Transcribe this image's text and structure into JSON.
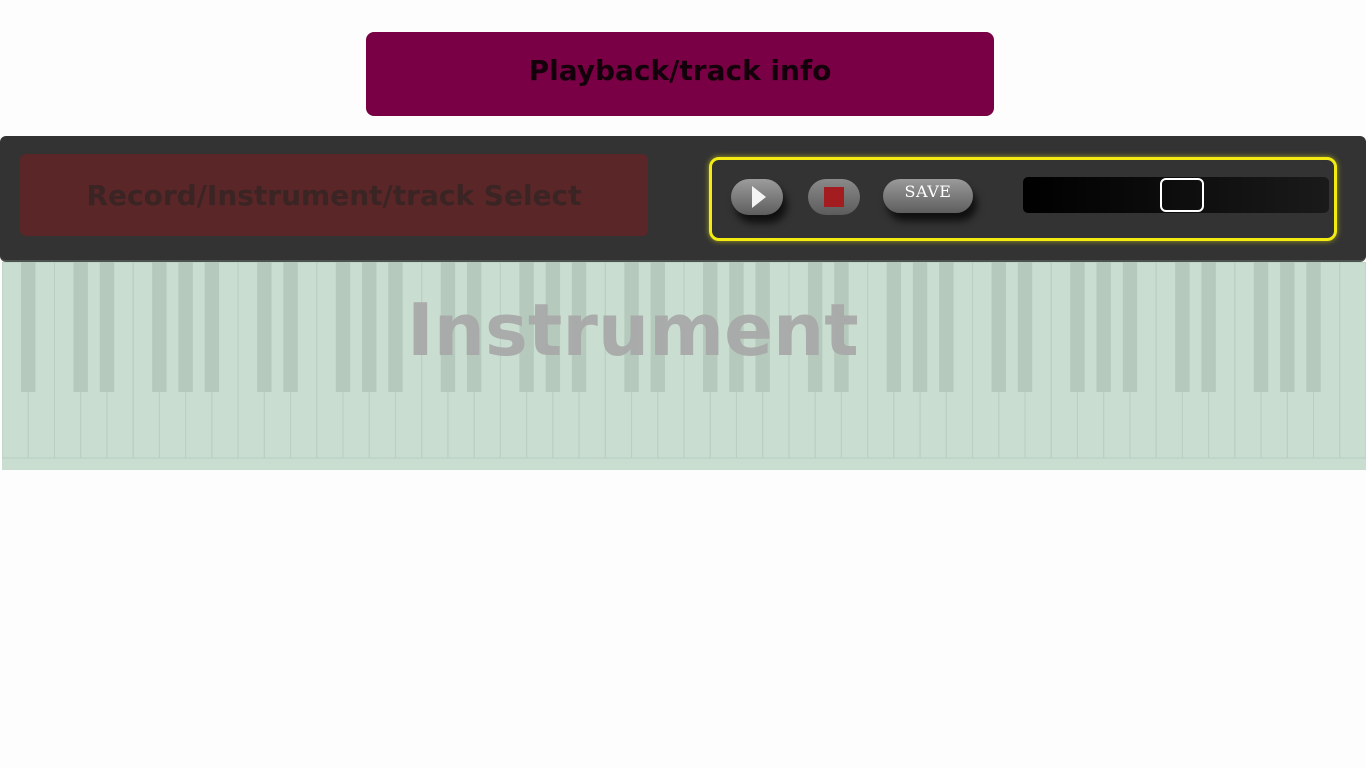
{
  "header": {
    "track_info_label": "Playback/track info"
  },
  "toolbar": {
    "record_select_label": "Record/Instrument/track Select",
    "play_icon": "play-icon",
    "stop_icon": "stop-icon",
    "save_label": "SAVE",
    "slider_value": 0.52
  },
  "instrument": {
    "label": "Instrument",
    "white_key_count": 52
  },
  "colors": {
    "track_info_bg": "#790044",
    "record_select_bg": "#5b2627",
    "control_bar_bg": "#333333",
    "transport_border": "#f2ec12",
    "stop_icon": "#a31d20",
    "keyboard_bg": "#c9ddd1"
  }
}
